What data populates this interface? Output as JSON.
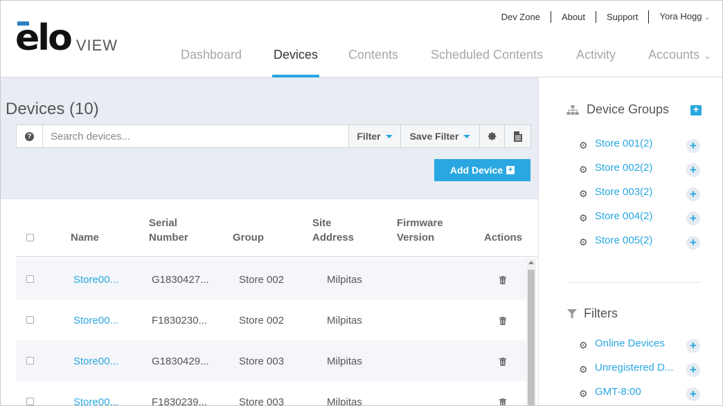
{
  "header": {
    "logo_main": "elo",
    "logo_sub": "VIEW",
    "top_links": [
      "Dev Zone",
      "About",
      "Support"
    ],
    "user_name": "Yora Hogg",
    "nav_tabs": [
      {
        "label": "Dashboard",
        "active": false
      },
      {
        "label": "Devices",
        "active": true
      },
      {
        "label": "Contents",
        "active": false
      },
      {
        "label": "Scheduled Contents",
        "active": false
      },
      {
        "label": "Activity",
        "active": false
      },
      {
        "label": "Accounts",
        "active": false,
        "dropdown": true
      }
    ]
  },
  "main": {
    "title": "Devices (10)",
    "search_placeholder": "Search devices...",
    "filter_label": "Filter",
    "save_filter_label": "Save Filter",
    "add_device_label": "Add Device"
  },
  "table": {
    "columns": {
      "name": "Name",
      "serial_1": "Serial",
      "serial_2": "Number",
      "group": "Group",
      "site_1": "Site",
      "site_2": "Address",
      "firmware_1": "Firmware",
      "firmware_2": "Version",
      "actions": "Actions"
    },
    "rows": [
      {
        "name": "Store00...",
        "serial": "G1830427...",
        "group": "Store 002",
        "site": "Milpitas",
        "firmware": ""
      },
      {
        "name": "Store00...",
        "serial": "F1830230...",
        "group": "Store 002",
        "site": "Milpitas",
        "firmware": ""
      },
      {
        "name": "Store00...",
        "serial": "G1830429...",
        "group": "Store 003",
        "site": "Milpitas",
        "firmware": ""
      },
      {
        "name": "Store00...",
        "serial": "F1830239...",
        "group": "Store 003",
        "site": "Milpitas",
        "firmware": ""
      }
    ]
  },
  "sidebar": {
    "groups_title": "Device Groups",
    "groups": [
      "Store 001(2)",
      "Store 002(2)",
      "Store 003(2)",
      "Store 004(2)",
      "Store 005(2)"
    ],
    "filters_title": "Filters",
    "filters": [
      "Online Devices",
      "Unregistered D...",
      "GMT-8:00"
    ]
  },
  "colors": {
    "accent": "#29a7e1",
    "toolbar_bg": "#e8ecf3",
    "logo_bar": "#2f7fc1"
  },
  "icons": [
    "help-icon",
    "caret-down-icon",
    "gear-icon",
    "report-icon",
    "plus-icon",
    "trash-icon",
    "sitemap-icon",
    "funnel-icon"
  ]
}
